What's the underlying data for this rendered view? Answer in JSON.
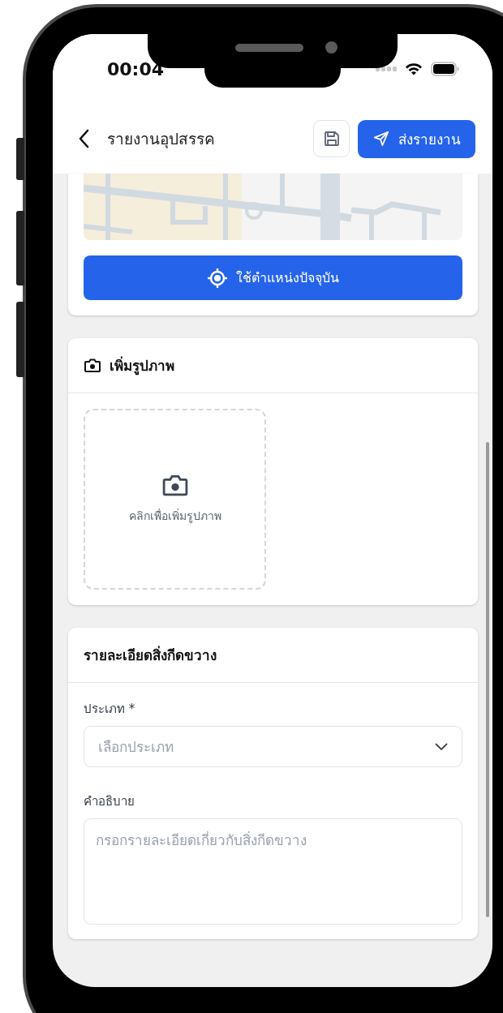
{
  "status_bar": {
    "time": "00:04"
  },
  "header": {
    "title": "รายงานอุปสรรค",
    "send_button": "ส่งรายงาน"
  },
  "location_card": {
    "button": "ใช้ตำแหน่งปัจจุบัน"
  },
  "photo_card": {
    "title": "เพิ่มรูปภาพ",
    "upload_hint": "คลิกเพื่อเพิ่มรูปภาพ"
  },
  "details_card": {
    "title": "รายละเอียดสิ่งกีดขวาง",
    "fields": [
      {
        "kind": "select",
        "label": "ประเภท *",
        "placeholder": "เลือกประเภท"
      },
      {
        "kind": "textarea",
        "label": "คำอธิบาย",
        "placeholder": "กรอกรายละเอียดเกี่ยวกับสิ่งกีดขวาง"
      }
    ]
  }
}
